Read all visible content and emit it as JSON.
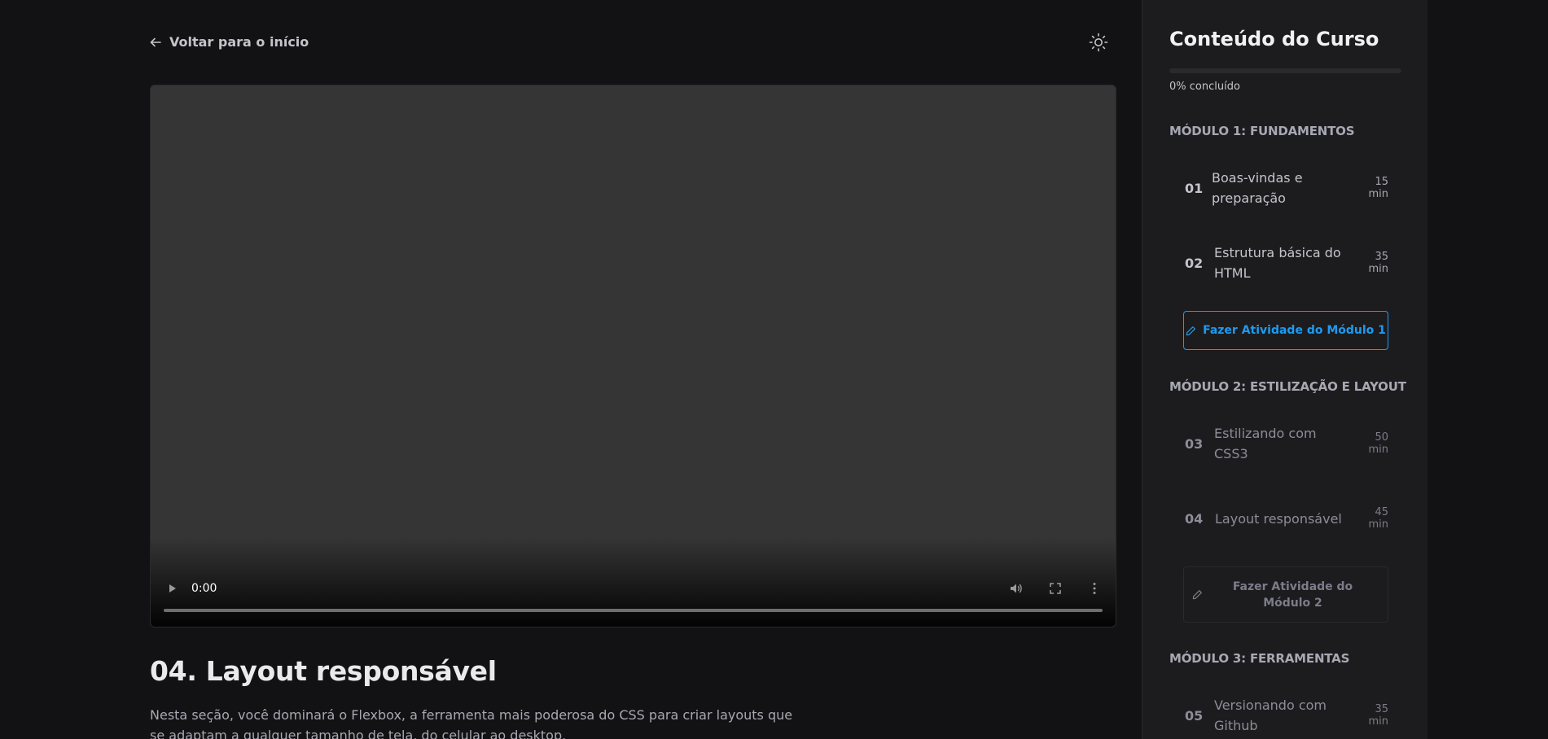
{
  "header": {
    "back_label": "Voltar para o início",
    "back_icon": "arrow-left-icon",
    "theme_icon": "sun-icon"
  },
  "video": {
    "current_time": "0:00",
    "played_fraction": 0
  },
  "lesson": {
    "title": "04. Layout responsável",
    "description": "Nesta seção, você dominará o Flexbox, a ferramenta mais poderosa do CSS para criar layouts que se adaptam a qualquer tamanho de tela, do celular ao desktop."
  },
  "sidebar": {
    "title": "Conteúdo do Curso",
    "progress_text": "0% concluído",
    "progress_percent": 0,
    "modules": [
      {
        "title": "MÓDULO 1: FUNDAMENTOS",
        "lessons": [
          {
            "number": "01",
            "name": "Boas-vindas e preparação",
            "duration": "15 min"
          },
          {
            "number": "02",
            "name": "Estrutura básica do HTML",
            "duration": "35 min"
          }
        ],
        "activity_label": "Fazer Atividade do Módulo 1"
      },
      {
        "title": "MÓDULO 2: ESTILIZAÇÃO E LAYOUT",
        "lessons": [
          {
            "number": "03",
            "name": "Estilizando com CSS3",
            "duration": "50 min"
          },
          {
            "number": "04",
            "name": "Layout responsável",
            "duration": "45 min"
          }
        ],
        "activity_label": "Fazer Atividade do Módulo 2"
      },
      {
        "title": "MÓDULO 3: FERRAMENTAS",
        "lessons": [
          {
            "number": "05",
            "name": "Versionando com Github",
            "duration": "35 min"
          }
        ]
      }
    ]
  },
  "colors": {
    "background": "#121214",
    "sidebar": "#1c1c1f",
    "accent_blue": "#1d9bf0",
    "progress": "#8257e5"
  }
}
